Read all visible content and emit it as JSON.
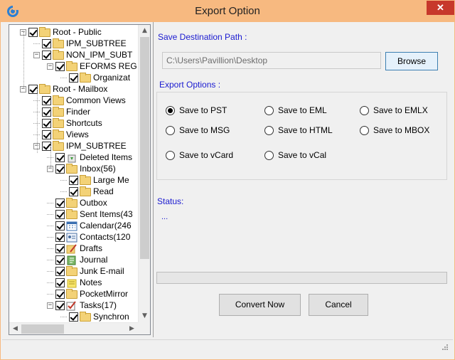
{
  "window": {
    "title": "Export Option",
    "close_glyph": "✕",
    "app_icon": "app-logo-icon"
  },
  "tree": {
    "nodes": [
      {
        "label": "Root - Public",
        "level": 0,
        "expander": "−",
        "icon": "folder"
      },
      {
        "label": "IPM_SUBTREE",
        "level": 1,
        "expander": "",
        "icon": "folder"
      },
      {
        "label": "NON_IPM_SUBT",
        "level": 1,
        "expander": "−",
        "icon": "folder"
      },
      {
        "label": "EFORMS REG",
        "level": 2,
        "expander": "−",
        "icon": "folder"
      },
      {
        "label": "Organizat",
        "level": 3,
        "expander": "",
        "icon": "folder"
      },
      {
        "label": "Root - Mailbox",
        "level": 0,
        "expander": "−",
        "icon": "folder"
      },
      {
        "label": "Common Views",
        "level": 1,
        "expander": "",
        "icon": "folder"
      },
      {
        "label": "Finder",
        "level": 1,
        "expander": "",
        "icon": "folder"
      },
      {
        "label": "Shortcuts",
        "level": 1,
        "expander": "",
        "icon": "folder"
      },
      {
        "label": "Views",
        "level": 1,
        "expander": "",
        "icon": "folder"
      },
      {
        "label": "IPM_SUBTREE",
        "level": 1,
        "expander": "−",
        "icon": "folder"
      },
      {
        "label": "Deleted Items",
        "level": 2,
        "expander": "",
        "icon": "recycle"
      },
      {
        "label": "Inbox(56)",
        "level": 2,
        "expander": "−",
        "icon": "folder"
      },
      {
        "label": "Large Me",
        "level": 3,
        "expander": "",
        "icon": "folder"
      },
      {
        "label": "Read",
        "level": 3,
        "expander": "",
        "icon": "folder"
      },
      {
        "label": "Outbox",
        "level": 2,
        "expander": "",
        "icon": "folder"
      },
      {
        "label": "Sent Items(43",
        "level": 2,
        "expander": "",
        "icon": "folder"
      },
      {
        "label": "Calendar(246",
        "level": 2,
        "expander": "",
        "icon": "calendar"
      },
      {
        "label": "Contacts(120",
        "level": 2,
        "expander": "",
        "icon": "contacts"
      },
      {
        "label": "Drafts",
        "level": 2,
        "expander": "",
        "icon": "drafts"
      },
      {
        "label": "Journal",
        "level": 2,
        "expander": "",
        "icon": "journal"
      },
      {
        "label": "Junk E-mail",
        "level": 2,
        "expander": "",
        "icon": "folder"
      },
      {
        "label": "Notes",
        "level": 2,
        "expander": "",
        "icon": "notes"
      },
      {
        "label": "PocketMirror",
        "level": 2,
        "expander": "",
        "icon": "folder"
      },
      {
        "label": "Tasks(17)",
        "level": 2,
        "expander": "−",
        "icon": "tasks"
      },
      {
        "label": "Synchron",
        "level": 3,
        "expander": "",
        "icon": "folder"
      }
    ],
    "scroll_up": "▲",
    "scroll_down": "▼",
    "scroll_left": "◀",
    "scroll_right": "▶"
  },
  "destination": {
    "label": "Save Destination Path :",
    "path": "C:\\Users\\Pavillion\\Desktop",
    "browse_label": "Browse"
  },
  "export": {
    "label": "Export Options :",
    "options": [
      {
        "label": "Save to PST",
        "selected": true
      },
      {
        "label": "Save to EML",
        "selected": false
      },
      {
        "label": "Save to EMLX",
        "selected": false
      },
      {
        "label": "Save to MSG",
        "selected": false
      },
      {
        "label": "Save to HTML",
        "selected": false
      },
      {
        "label": "Save to MBOX",
        "selected": false
      },
      {
        "label": "Save to vCard",
        "selected": false
      },
      {
        "label": "Save to vCal",
        "selected": false
      }
    ]
  },
  "status": {
    "label": "Status:",
    "value": "...",
    "progress": 0
  },
  "actions": {
    "convert_label": "Convert Now",
    "cancel_label": "Cancel"
  },
  "colors": {
    "titlebar": "#f7b980",
    "close": "#c7382b",
    "label_blue": "#1a1ad0"
  }
}
